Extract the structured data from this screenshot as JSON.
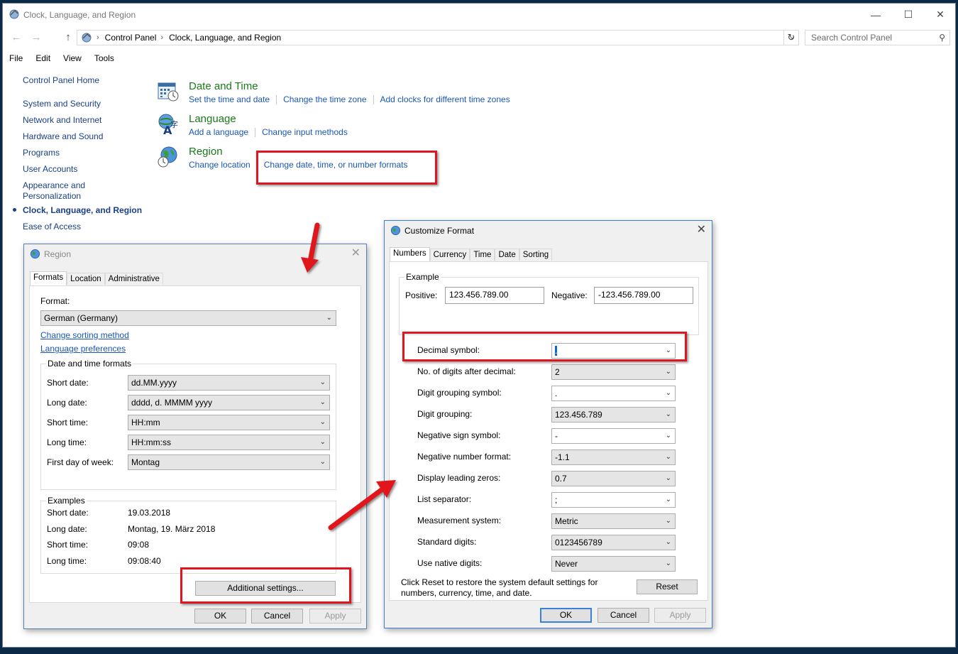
{
  "window": {
    "title": "Clock, Language, and Region",
    "minimize": "—",
    "maximize": "☐",
    "close": "✕"
  },
  "nav": {
    "back": "←",
    "forward": "→",
    "up": "↑",
    "breadcrumb": [
      "Control Panel",
      "Clock, Language, and Region"
    ],
    "search_placeholder": "Search Control Panel"
  },
  "menu": [
    "File",
    "Edit",
    "View",
    "Tools"
  ],
  "sidebar": {
    "home": "Control Panel Home",
    "items": [
      "System and Security",
      "Network and Internet",
      "Hardware and Sound",
      "Programs",
      "User Accounts",
      "Appearance and",
      "Personalization",
      "Clock, Language, and Region",
      "Ease of Access"
    ]
  },
  "categories": {
    "datetime": {
      "title": "Date and Time",
      "links": [
        "Set the time and date",
        "Change the time zone",
        "Add clocks for different time zones"
      ]
    },
    "language": {
      "title": "Language",
      "links": [
        "Add a language",
        "Change input methods"
      ]
    },
    "region": {
      "title": "Region",
      "links": [
        "Change location",
        "Change date, time, or number formats"
      ]
    }
  },
  "region_dialog": {
    "title": "Region",
    "tabs": [
      "Formats",
      "Location",
      "Administrative"
    ],
    "format_label": "Format:",
    "format_value": "German (Germany)",
    "link_sorting": "Change sorting method",
    "link_lang": "Language preferences",
    "dt_group": "Date and time formats",
    "rows": [
      {
        "label": "Short date:",
        "value": "dd.MM.yyyy"
      },
      {
        "label": "Long date:",
        "value": "dddd, d. MMMM yyyy"
      },
      {
        "label": "Short time:",
        "value": "HH:mm"
      },
      {
        "label": "Long time:",
        "value": "HH:mm:ss"
      },
      {
        "label": "First day of week:",
        "value": "Montag"
      }
    ],
    "examples_group": "Examples",
    "examples": [
      {
        "label": "Short date:",
        "value": "19.03.2018"
      },
      {
        "label": "Long date:",
        "value": "Montag, 19. März 2018"
      },
      {
        "label": "Short time:",
        "value": "09:08"
      },
      {
        "label": "Long time:",
        "value": "09:08:40"
      }
    ],
    "additional": "Additional settings...",
    "ok": "OK",
    "cancel": "Cancel",
    "apply": "Apply"
  },
  "customize_dialog": {
    "title": "Customize Format",
    "tabs": [
      "Numbers",
      "Currency",
      "Time",
      "Date",
      "Sorting"
    ],
    "example_group": "Example",
    "positive_label": "Positive:",
    "positive_value": "123.456.789.00",
    "negative_label": "Negative:",
    "negative_value": "-123.456.789.00",
    "rows": [
      {
        "label": "Decimal symbol:",
        "value": ".",
        "white": true
      },
      {
        "label": "No. of digits after decimal:",
        "value": "2",
        "white": false
      },
      {
        "label": "Digit grouping symbol:",
        "value": ".",
        "white": true
      },
      {
        "label": "Digit grouping:",
        "value": "123.456.789",
        "white": false
      },
      {
        "label": "Negative sign symbol:",
        "value": "-",
        "white": true
      },
      {
        "label": "Negative number format:",
        "value": "-1.1",
        "white": false
      },
      {
        "label": "Display leading zeros:",
        "value": "0.7",
        "white": false
      },
      {
        "label": "List separator:",
        "value": ";",
        "white": true
      },
      {
        "label": "Measurement system:",
        "value": "Metric",
        "white": false
      },
      {
        "label": "Standard digits:",
        "value": "0123456789",
        "white": false
      },
      {
        "label": "Use native digits:",
        "value": "Never",
        "white": false
      }
    ],
    "reset_text_1": "Click Reset to restore the system default settings for",
    "reset_text_2": "numbers, currency, time, and date.",
    "reset": "Reset",
    "ok": "OK",
    "cancel": "Cancel",
    "apply": "Apply"
  },
  "colors": {
    "annotation_red": "#e0151f",
    "link_blue": "#1a57b5",
    "category_green": "#1a7a1a"
  }
}
